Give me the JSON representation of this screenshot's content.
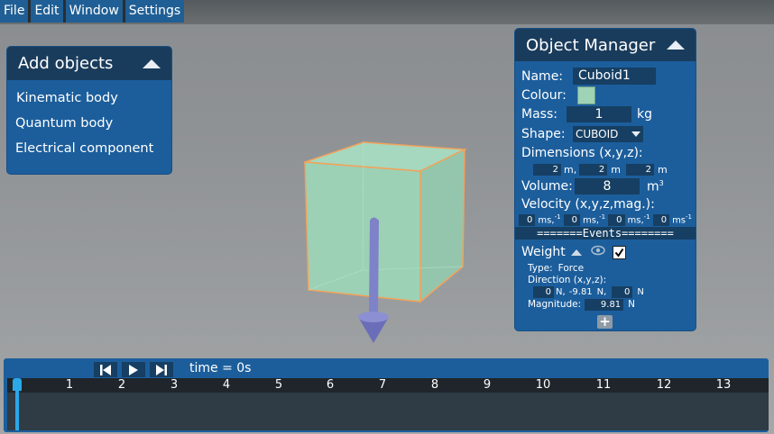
{
  "menu": [
    "File",
    "Edit",
    "Window",
    "Settings"
  ],
  "add_objects": {
    "title": "Add objects",
    "items": [
      "Kinematic body",
      "Quantum body",
      "Electrical component"
    ]
  },
  "object_manager": {
    "title": "Object Manager",
    "name_label": "Name:",
    "name_value": "Cuboid1",
    "colour_label": "Colour:",
    "colour_value": "#9fd3b6",
    "mass_label": "Mass:",
    "mass_value": "1",
    "mass_unit": "kg",
    "shape_label": "Shape:",
    "shape_value": "CUBOID",
    "dimensions_label": "Dimensions (x,y,z):",
    "dim_x": "2",
    "dim_y": "2",
    "dim_z": "2",
    "dim_unit_x": "m,",
    "dim_unit_y": "m",
    "dim_unit_z": "m",
    "volume_label": "Volume:",
    "volume_value": "8",
    "volume_unit": "m",
    "volume_exp": "3",
    "velocity_label": "Velocity (x,y,z,mag.):",
    "vel_x": "0",
    "vel_y": "0",
    "vel_z": "0",
    "vel_mag": "0",
    "vel_unit_sep": "ms,",
    "vel_unit_last": "ms",
    "vel_exp": "-1",
    "events_separator": "=======Events========",
    "event": {
      "name": "Weight",
      "type_label": "Type:",
      "type_value": "Force",
      "direction_label": "Direction (x,y,z):",
      "dir_x": "0",
      "dir_y": "-9.81",
      "dir_z": "0",
      "dir_unit_sep": "N,",
      "dir_unit_last": "N",
      "magnitude_label": "Magnitude:",
      "magnitude_value": "9.81",
      "magnitude_unit": "N",
      "visible_checked": true
    },
    "add_event_label": "+"
  },
  "timeline": {
    "time_label": "time = 0s",
    "ticks": [
      "0",
      "1",
      "2",
      "3",
      "4",
      "5",
      "6",
      "7",
      "8",
      "9",
      "10",
      "11",
      "12",
      "13"
    ]
  },
  "colors": {
    "panel": "#1c5e9c",
    "panel_header": "#1a3c5c",
    "field": "#163f63",
    "cuboid_fill": "#9fd3b6",
    "cuboid_edge": "#f3a25a",
    "arrow": "#7e82c8",
    "playhead": "#2aa8e8"
  }
}
